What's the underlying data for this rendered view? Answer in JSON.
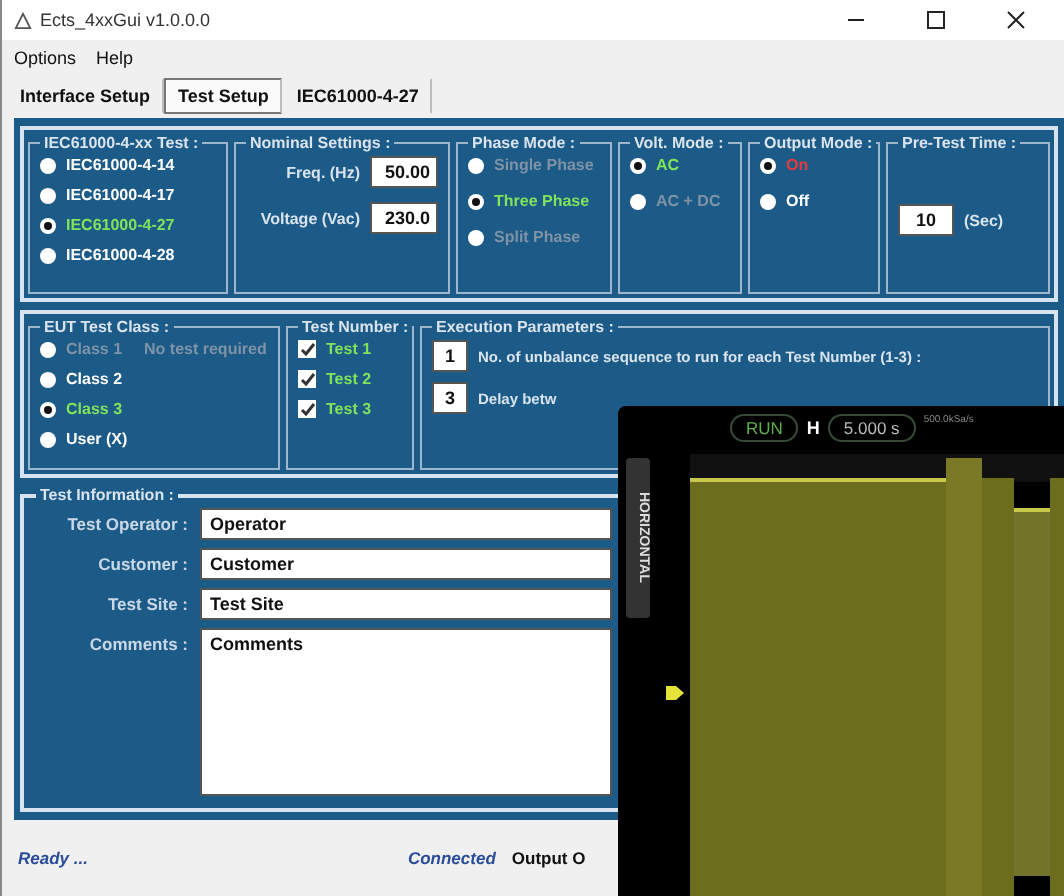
{
  "window": {
    "title": "Ects_4xxGui v1.0.0.0"
  },
  "menu": [
    "Options",
    "Help"
  ],
  "tabs": [
    {
      "label": "Interface Setup",
      "selected": false
    },
    {
      "label": "Test Setup",
      "selected": true
    },
    {
      "label": "IEC61000-4-27",
      "selected": false
    }
  ],
  "test_select": {
    "title": "IEC61000-4-xx Test :",
    "options": [
      {
        "label": "IEC61000-4-14",
        "selected": false,
        "disabled": false
      },
      {
        "label": "IEC61000-4-17",
        "selected": false,
        "disabled": false
      },
      {
        "label": "IEC61000-4-27",
        "selected": true,
        "disabled": false
      },
      {
        "label": "IEC61000-4-28",
        "selected": false,
        "disabled": false
      }
    ]
  },
  "nominal": {
    "title": "Nominal Settings :",
    "fields": [
      {
        "label": "Freq. (Hz)",
        "value": "50.00"
      },
      {
        "label": "Voltage (Vac)",
        "value": "230.0"
      }
    ]
  },
  "phase_mode": {
    "title": "Phase Mode :",
    "options": [
      {
        "label": "Single Phase",
        "selected": false,
        "disabled": true
      },
      {
        "label": "Three Phase",
        "selected": true,
        "disabled": false
      },
      {
        "label": "Split Phase",
        "selected": false,
        "disabled": true
      }
    ]
  },
  "volt_mode": {
    "title": "Volt. Mode :",
    "options": [
      {
        "label": "AC",
        "selected": true,
        "disabled": false
      },
      {
        "label": "AC + DC",
        "selected": false,
        "disabled": true
      }
    ]
  },
  "output_mode": {
    "title": "Output Mode :",
    "options": [
      {
        "label": "On",
        "selected": true,
        "disabled": false,
        "color": "#e23b3b"
      },
      {
        "label": "Off",
        "selected": false,
        "disabled": false,
        "color": "#ffffff"
      }
    ]
  },
  "pre_test": {
    "title": "Pre-Test Time :",
    "value": "10",
    "unit": "(Sec)"
  },
  "eut_class": {
    "title": "EUT Test Class :",
    "options": [
      {
        "label": "Class 1",
        "note": "No test required",
        "selected": false,
        "disabled": true
      },
      {
        "label": "Class 2",
        "selected": false,
        "disabled": false
      },
      {
        "label": "Class 3",
        "selected": true,
        "disabled": false
      },
      {
        "label": "User (X)",
        "selected": false,
        "disabled": false
      }
    ]
  },
  "test_number": {
    "title": "Test Number :",
    "items": [
      {
        "label": "Test 1",
        "checked": true
      },
      {
        "label": "Test 2",
        "checked": true
      },
      {
        "label": "Test 3",
        "checked": true
      }
    ]
  },
  "execution": {
    "title": "Execution Parameters :",
    "params": [
      {
        "value": "1",
        "label": "No. of unbalance sequence to run for each Test Number (1-3) :"
      },
      {
        "value": "3",
        "label": "Delay betw"
      }
    ]
  },
  "test_info": {
    "title": "Test Information :",
    "fields": [
      {
        "label": "Test Operator :",
        "value": "Operator",
        "kind": "line"
      },
      {
        "label": "Customer :",
        "value": "Customer",
        "kind": "line"
      },
      {
        "label": "Test Site :",
        "value": "Test Site",
        "kind": "line"
      },
      {
        "label": "Comments :",
        "value": "Comments",
        "kind": "area"
      }
    ]
  },
  "status_bar": [
    {
      "text": "Ready ...",
      "kind": "status"
    },
    {
      "text": "Connected",
      "kind": "status"
    },
    {
      "text": "Output O",
      "kind": "label"
    }
  ],
  "scope": {
    "run": "RUN",
    "h": "H",
    "timebase": "5.000 s",
    "sample_rate": "500.0kSa/s",
    "side_tab": "HORIZONTAL"
  }
}
